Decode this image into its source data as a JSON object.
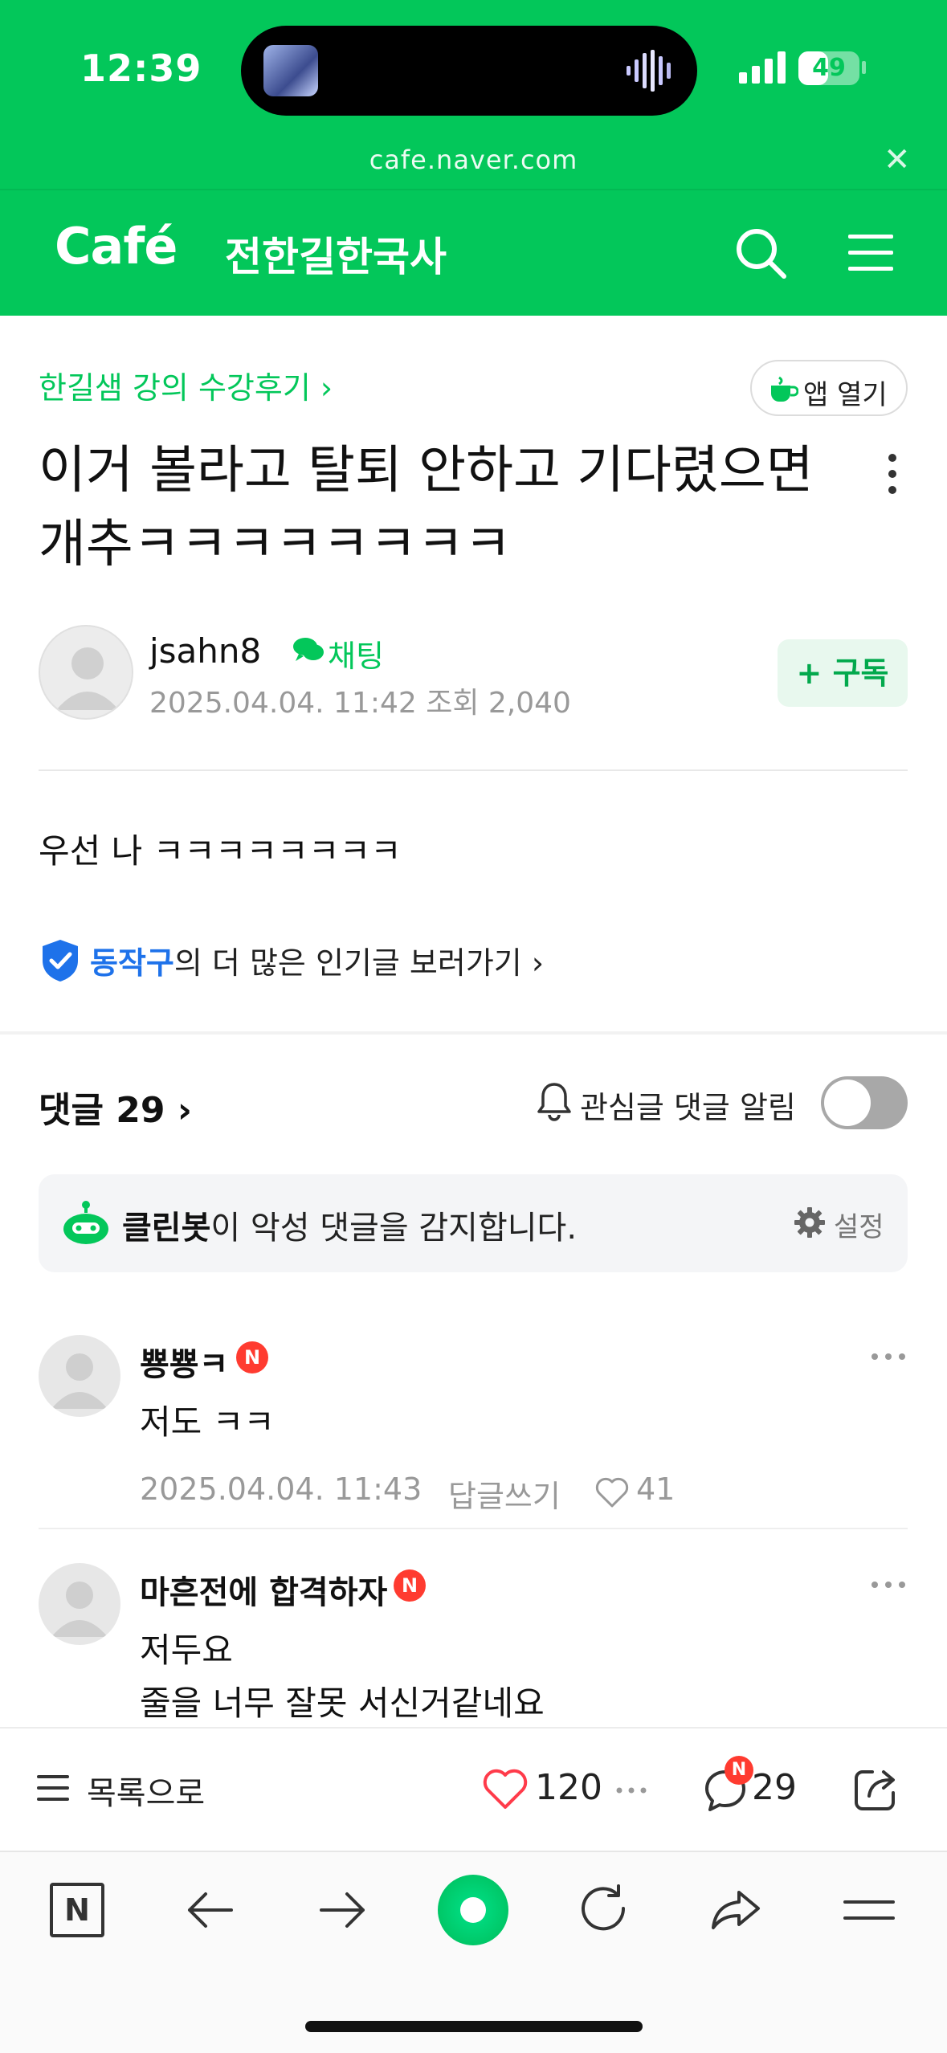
{
  "status_bar": {
    "time": "12:39",
    "battery": "49",
    "battery_level": 0.49
  },
  "browser": {
    "url": "cafe.naver.com"
  },
  "header": {
    "logo": "Café",
    "cafe_name": "전한길한국사"
  },
  "article": {
    "board": "한길샘 강의 수강후기 ›",
    "app_open": "앱 열기",
    "title": "이거 볼라고 탈퇴 안하고 기다렸으면 개추ㅋㅋㅋㅋㅋㅋㅋㅋ",
    "author": "jsahn8",
    "chat": "채팅",
    "meta": "2025.04.04. 11:42  조회 2,040",
    "subscribe": "+ 구독",
    "body": "우선 나 ㅋㅋㅋㅋㅋㅋㅋㅋ",
    "popular_name": "동작구",
    "popular_rest": "의 더 많은 인기글 보러가기 ›"
  },
  "comments_section": {
    "title": "댓글 29 ›",
    "alert_label": "관심글 댓글 알림",
    "alert_on": false,
    "cleanbot_name": "클린봇",
    "cleanbot_rest": "이 악성 댓글을 감지합니다.",
    "settings": "설정"
  },
  "comments": [
    {
      "name": "뿅뿅ㅋ",
      "badge": "N",
      "text": "저도 ㅋㅋ",
      "date": "2025.04.04. 11:43",
      "reply": "답글쓰기",
      "likes": "41"
    },
    {
      "name": "마흔전에 합격하자",
      "badge": "N",
      "text": "저두요\n줄을 너무 잘못 서신거같네요",
      "date": "",
      "reply": "",
      "likes": ""
    }
  ],
  "action_bar": {
    "list_label": "목록으로",
    "like_count": "120",
    "comment_badge": "N",
    "comment_count": "29"
  },
  "browser_bar": {
    "naver_label": "N"
  },
  "colors": {
    "brand": "#03c75a",
    "link_blue": "#1e72ea",
    "badge_red": "#ff3b30"
  }
}
